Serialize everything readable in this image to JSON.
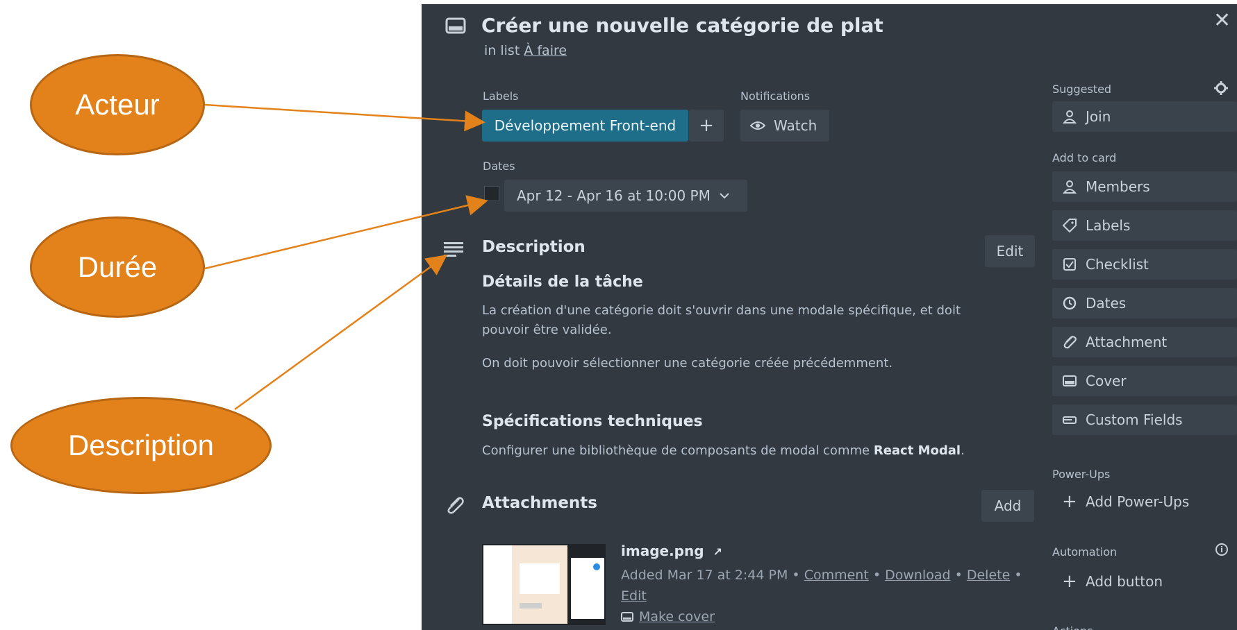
{
  "annotations": {
    "acteur": "Acteur",
    "duree": "Durée",
    "description": "Description"
  },
  "card": {
    "title": "Créer une nouvelle catégorie de plat",
    "in_list_prefix": "in list",
    "list_name": "À faire",
    "close_glyph": "✕"
  },
  "labels": {
    "heading": "Labels",
    "chip": "Développement Front-end",
    "add_glyph": "+"
  },
  "notifications": {
    "heading": "Notifications",
    "watch": "Watch"
  },
  "dates": {
    "heading": "Dates",
    "value": "Apr 12 - Apr 16 at 10:00 PM"
  },
  "description": {
    "heading": "Description",
    "edit": "Edit",
    "details_title": "Détails de la tâche",
    "details_p1_line1": "La création d'une catégorie doit s'ouvrir dans une modale spécifique, et doit",
    "details_p1_line2": "pouvoir être validée.",
    "details_p2": "On doit pouvoir sélectionner une catégorie créée précédemment.",
    "specs_title": "Spécifications techniques",
    "specs_text": "Configurer une bibliothèque de composants de modal comme",
    "specs_bold": "React Modal",
    "specs_end": "."
  },
  "attachments": {
    "heading": "Attachments",
    "add": "Add",
    "file_name": "image.png",
    "added": "Added Mar 17 at 2:44 PM",
    "sep": "•",
    "comment": "Comment",
    "download": "Download",
    "delete": "Delete",
    "edit": "Edit",
    "make_cover": "Make cover"
  },
  "sidebar": {
    "suggested": "Suggested",
    "join": "Join",
    "add_to_card": "Add to card",
    "members": "Members",
    "labels": "Labels",
    "checklist": "Checklist",
    "dates": "Dates",
    "attachment": "Attachment",
    "cover": "Cover",
    "custom_fields": "Custom Fields",
    "power_ups": "Power-Ups",
    "add_power_ups": "Add Power-Ups",
    "automation": "Automation",
    "add_button": "Add button",
    "actions": "Actions"
  },
  "colors": {
    "modal_bg": "#323940",
    "label_chip": "#1e6d89",
    "annotation": "#e3821a"
  }
}
